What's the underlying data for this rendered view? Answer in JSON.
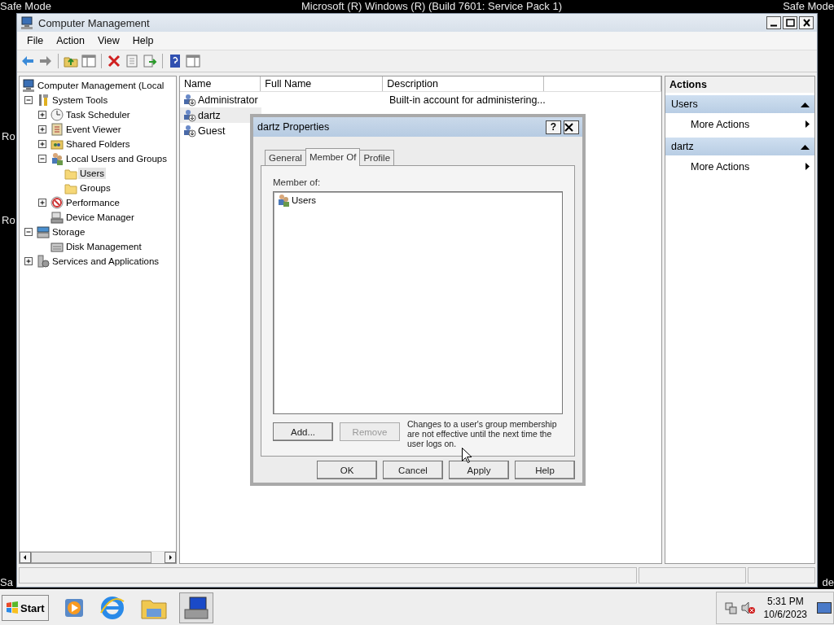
{
  "desktop": {
    "banner": "Microsoft (R) Windows (R) (Build 7601: Service Pack 1)",
    "safe_mode_labels": [
      "Safe Mode",
      "Safe Mode",
      "Sa",
      "de"
    ],
    "edge_texts": [
      "Ro",
      "Ro"
    ]
  },
  "window": {
    "title": "Computer Management"
  },
  "menu": [
    "File",
    "Action",
    "View",
    "Help"
  ],
  "tree": {
    "label": "Computer Management (Local",
    "kind": "computer",
    "selected": false,
    "children": [
      {
        "label": "System Tools",
        "kind": "tools",
        "expanded": true,
        "selected": false,
        "children": [
          {
            "label": "Task Scheduler",
            "kind": "clock",
            "expanded": false,
            "selected": false
          },
          {
            "label": "Event Viewer",
            "kind": "log",
            "expanded": false,
            "selected": false
          },
          {
            "label": "Shared Folders",
            "kind": "share",
            "expanded": false,
            "selected": false
          },
          {
            "label": "Local Users and Groups",
            "kind": "users",
            "expanded": true,
            "selected": false,
            "children": [
              {
                "label": "Users",
                "kind": "folder",
                "selected": true
              },
              {
                "label": "Groups",
                "kind": "folder",
                "selected": false
              }
            ]
          },
          {
            "label": "Performance",
            "kind": "gauge",
            "expanded": false,
            "selected": false
          },
          {
            "label": "Device Manager",
            "kind": "device",
            "selected": false
          }
        ]
      },
      {
        "label": "Storage",
        "kind": "storage",
        "expanded": true,
        "selected": false,
        "children": [
          {
            "label": "Disk Management",
            "kind": "disk",
            "selected": false
          }
        ]
      },
      {
        "label": "Services and Applications",
        "kind": "services",
        "expanded": false,
        "selected": false
      }
    ]
  },
  "table": {
    "columns": [
      "Name",
      "Full Name",
      "Description"
    ],
    "rows": [
      {
        "name": "Administrator",
        "description": "Built-in account for administering...",
        "selected": false
      },
      {
        "name": "dartz",
        "selected": true
      },
      {
        "name": "Guest",
        "selected": false
      }
    ]
  },
  "actions": {
    "title": "Actions",
    "sections": [
      {
        "title": "Users",
        "expanded": true,
        "items": [
          "More Actions"
        ]
      },
      {
        "title": "dartz",
        "expanded": true,
        "items": [
          "More Actions"
        ]
      }
    ]
  },
  "dialog": {
    "title": "dartz Properties",
    "help_button": "?",
    "tabs": [
      {
        "label": "General",
        "selected": false
      },
      {
        "label": "Member Of",
        "selected": true
      },
      {
        "label": "Profile",
        "selected": false
      }
    ],
    "member_of_label": "Member of:",
    "groups": [
      "Users"
    ],
    "buttons": [
      {
        "label": "Add...",
        "disabled": false
      },
      {
        "label": "Remove",
        "disabled": true
      }
    ],
    "note": "Changes to a user's group membership are not effective until the next time the user logs on.",
    "footer_buttons": [
      "OK",
      "Cancel",
      "Apply",
      "Help"
    ]
  },
  "taskbar": {
    "start": "Start",
    "time": "5:31 PM",
    "date": "10/6/2023"
  }
}
